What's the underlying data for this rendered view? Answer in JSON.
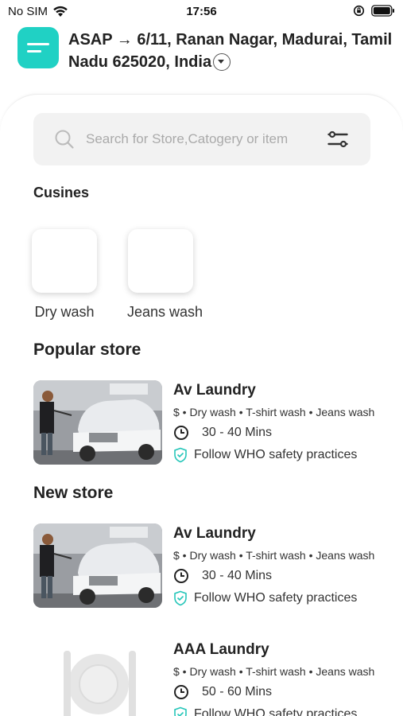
{
  "status_bar": {
    "carrier": "No SIM",
    "time": "17:56"
  },
  "header": {
    "address": "ASAP → 6/11, Ranan Nagar, Madurai, Tamil Nadu 625020, India"
  },
  "search": {
    "placeholder": "Search for Store,Catogery or item"
  },
  "cusines": {
    "title": "Cusines",
    "items": [
      {
        "label": "Dry wash"
      },
      {
        "label": "Jeans wash"
      }
    ]
  },
  "popular": {
    "title": "Popular store",
    "stores": [
      {
        "name": "Av Laundry",
        "tags": "$ • Dry wash • T-shirt wash • Jeans wash",
        "time": "30 - 40 Mins",
        "safety": "Follow WHO safety practices"
      }
    ]
  },
  "new_stores": {
    "title": "New store",
    "stores": [
      {
        "name": "Av Laundry",
        "tags": "$ • Dry wash • T-shirt wash • Jeans wash",
        "time": "30 - 40 Mins",
        "safety": "Follow WHO safety practices"
      },
      {
        "name": "AAA Laundry",
        "tags": "$ • Dry wash • T-shirt wash • Jeans wash",
        "time": "50 - 60 Mins",
        "safety": "Follow WHO safety practices"
      }
    ]
  },
  "colors": {
    "accent": "#20d1c4",
    "shield": "#26c6b9"
  }
}
